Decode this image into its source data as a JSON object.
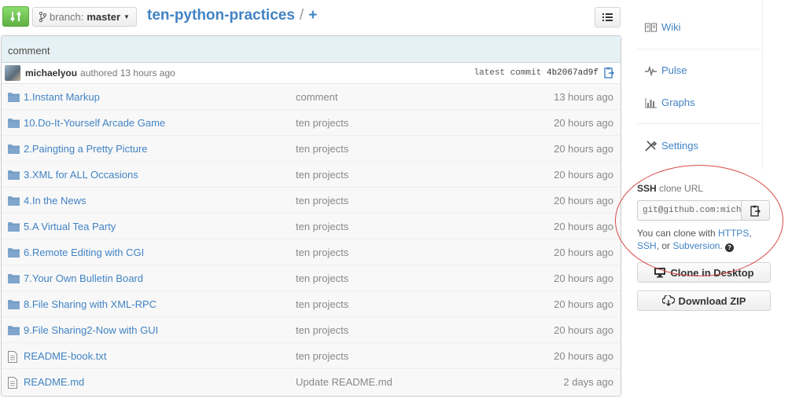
{
  "toolbar": {
    "branch_prefix": "branch:",
    "branch_name": "master",
    "repo_name": "ten-python-practices",
    "separator": "/",
    "plus": "+"
  },
  "commit": {
    "message": "comment",
    "author": "michaelyou",
    "authored": "authored 13 hours ago",
    "latest_label": "latest commit",
    "sha": "4b2067ad9f"
  },
  "files": [
    {
      "name": "1.Instant Markup",
      "message": "comment",
      "age": "13 hours ago",
      "type": "folder"
    },
    {
      "name": "10.Do-It-Yourself Arcade Game",
      "message": "ten projects",
      "age": "20 hours ago",
      "type": "folder"
    },
    {
      "name": "2.Paingting a Pretty Picture",
      "message": "ten projects",
      "age": "20 hours ago",
      "type": "folder"
    },
    {
      "name": "3.XML for ALL Occasions",
      "message": "ten projects",
      "age": "20 hours ago",
      "type": "folder"
    },
    {
      "name": "4.In the News",
      "message": "ten projects",
      "age": "20 hours ago",
      "type": "folder"
    },
    {
      "name": "5.A Virtual Tea Party",
      "message": "ten projects",
      "age": "20 hours ago",
      "type": "folder"
    },
    {
      "name": "6.Remote Editing with CGI",
      "message": "ten projects",
      "age": "20 hours ago",
      "type": "folder"
    },
    {
      "name": "7.Your Own Bulletin Board",
      "message": "ten projects",
      "age": "20 hours ago",
      "type": "folder"
    },
    {
      "name": "8.File Sharing with XML-RPC",
      "message": "ten projects",
      "age": "20 hours ago",
      "type": "folder"
    },
    {
      "name": "9.File Sharing2-Now with GUI",
      "message": "ten projects",
      "age": "20 hours ago",
      "type": "folder"
    },
    {
      "name": "README-book.txt",
      "message": "ten projects",
      "age": "20 hours ago",
      "type": "file"
    },
    {
      "name": "README.md",
      "message": "Update README.md",
      "age": "2 days ago",
      "type": "file"
    }
  ],
  "sidebar": {
    "wiki": "Wiki",
    "pulse": "Pulse",
    "graphs": "Graphs",
    "settings": "Settings"
  },
  "clone": {
    "protocol": "SSH",
    "label_rest": "clone URL",
    "url": "git@github.com:michaelyou/ten-python-practices.git",
    "help_prefix": "You can clone with",
    "https": "HTTPS",
    "ssh": "SSH",
    "or": "or",
    "subversion": "Subversion",
    "clone_desktop": "Clone in Desktop",
    "download_zip": "Download ZIP"
  },
  "colors": {
    "link": "#4183c4",
    "commit_bar": "#e6f1f6",
    "annotation": "#d84a4a",
    "compare_green": "#60b044"
  }
}
